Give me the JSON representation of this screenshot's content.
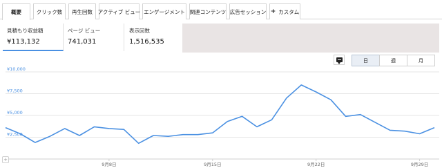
{
  "tabs": [
    {
      "label": "概要",
      "active": true
    },
    {
      "label": "クリック数"
    },
    {
      "label": "再生回数"
    },
    {
      "label": "アクティブ ビュー"
    },
    {
      "label": "エンゲージメント"
    },
    {
      "label": "関連コンテンツ"
    },
    {
      "label": "広告セッション"
    },
    {
      "label": "カスタム",
      "icon": "plus-icon"
    }
  ],
  "metrics": [
    {
      "label": "見積もり収益額",
      "value": "¥113,132",
      "selected": true
    },
    {
      "label": "ページ ビュー",
      "value": "741,031"
    },
    {
      "label": "表示回数",
      "value": "1,516,535"
    }
  ],
  "toolbar": {
    "annotation_icon": "comment-icon",
    "periods": [
      "日",
      "週",
      "月"
    ],
    "active_period": "日"
  },
  "expand_icon": "plus-icon",
  "colors": {
    "series": "#4a90e2",
    "active_tab_underline": "#4a90e2",
    "placeholder": "#e9e4e4"
  },
  "chart_data": {
    "type": "line",
    "title": "",
    "xlabel": "",
    "ylabel": "",
    "grid": true,
    "ylim": [
      0,
      10000
    ],
    "y_ticks": [
      {
        "value": 2500,
        "label": "¥2,500"
      },
      {
        "value": 5000,
        "label": "¥5,000"
      },
      {
        "value": 7500,
        "label": "¥7,500"
      },
      {
        "value": 10000,
        "label": "¥10,000"
      }
    ],
    "x_ticks": [
      {
        "index": 7,
        "label": "9月8日"
      },
      {
        "index": 14,
        "label": "9月15日"
      },
      {
        "index": 21,
        "label": "9月22日"
      },
      {
        "index": 28,
        "label": "9月29日"
      }
    ],
    "x": [
      "9月1日",
      "9月2日",
      "9月3日",
      "9月4日",
      "9月5日",
      "9月6日",
      "9月7日",
      "9月8日",
      "9月9日",
      "9月10日",
      "9月11日",
      "9月12日",
      "9月13日",
      "9月14日",
      "9月15日",
      "9月16日",
      "9月17日",
      "9月18日",
      "9月19日",
      "9月20日",
      "9月21日",
      "9月22日",
      "9月23日",
      "9月24日",
      "9月25日",
      "9月26日",
      "9月27日",
      "9月28日",
      "9月29日",
      "9月30日"
    ],
    "series": [
      {
        "values": [
          3600,
          2900,
          1900,
          2600,
          3500,
          2700,
          3700,
          3500,
          3400,
          1800,
          2700,
          2600,
          2800,
          2800,
          3000,
          4300,
          4900,
          3700,
          4500,
          7000,
          8500,
          7700,
          6800,
          4900,
          5100,
          4200,
          3300,
          3200,
          2900,
          3600
        ]
      }
    ]
  }
}
